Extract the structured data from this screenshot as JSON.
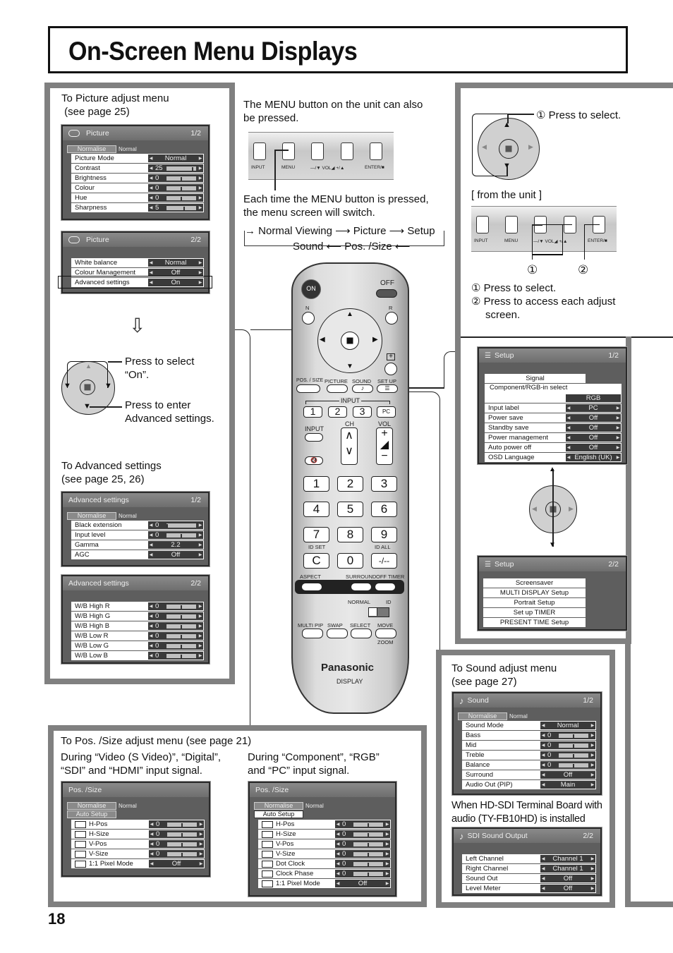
{
  "page": {
    "title": "On-Screen Menu Displays",
    "number": "18"
  },
  "left": {
    "picture_caption": [
      "To Picture adjust menu",
      " (see page 25)"
    ],
    "press_select": [
      "Press to select",
      "“On”."
    ],
    "press_enter": [
      "Press to enter",
      "Advanced settings."
    ],
    "adv_caption": [
      "To Advanced settings",
      "(see page 25, 26)"
    ]
  },
  "picture1": {
    "title": "Picture",
    "page": "1/2",
    "normalise": "Normalise",
    "normal_text": "Normal",
    "rows": [
      {
        "label": "Picture Mode",
        "value": "Normal"
      },
      {
        "label": "Contrast",
        "value": "25",
        "slider": 0.9
      },
      {
        "label": "Brightness",
        "value": "0",
        "slider": 0.5
      },
      {
        "label": "Colour",
        "value": "0",
        "slider": 0.5
      },
      {
        "label": "Hue",
        "value": "0",
        "slider": 0.5
      },
      {
        "label": "Sharpness",
        "value": "5",
        "slider": 0.6
      }
    ]
  },
  "picture2": {
    "title": "Picture",
    "page": "2/2",
    "rows": [
      {
        "label": "White balance",
        "value": "Normal"
      },
      {
        "label": "Colour Management",
        "value": "Off"
      },
      {
        "label": "Advanced settings",
        "value": "On"
      }
    ]
  },
  "adv1": {
    "title": "Advanced settings",
    "page": "1/2",
    "normalise": "Normalise",
    "normal_text": "Normal",
    "rows": [
      {
        "label": "Black extension",
        "value": "0",
        "slider": 0.0
      },
      {
        "label": "Input level",
        "value": "0",
        "slider": 0.5
      },
      {
        "label": "Gamma",
        "value": "2.2"
      },
      {
        "label": "AGC",
        "value": "Off"
      }
    ]
  },
  "adv2": {
    "title": "Advanced settings",
    "page": "2/2",
    "rows": [
      {
        "label": "W/B High R",
        "value": "0",
        "slider": 0.5
      },
      {
        "label": "W/B High G",
        "value": "0",
        "slider": 0.5
      },
      {
        "label": "W/B High B",
        "value": "0",
        "slider": 0.5
      },
      {
        "label": "W/B Low R",
        "value": "0",
        "slider": 0.5
      },
      {
        "label": "W/B Low G",
        "value": "0",
        "slider": 0.5
      },
      {
        "label": "W/B Low B",
        "value": "0",
        "slider": 0.5
      }
    ]
  },
  "center": {
    "menu_note": [
      "The MENU button on the unit can also",
      "be pressed."
    ],
    "each_time": [
      "Each time the MENU button is pressed,",
      "the menu screen will switch."
    ],
    "cycle": {
      "a": "Normal Viewing",
      "b": "Picture",
      "c": "Setup",
      "d": "Sound",
      "e": "Pos. /Size"
    },
    "unit_labels": [
      "INPUT",
      "MENU",
      "—/▼ VOL◢ +/▲",
      "ENTER/■"
    ]
  },
  "remote": {
    "on": "ON",
    "off": "OFF",
    "n": "N",
    "r": "R",
    "pos_size": "POS. / SIZE",
    "picture": "PICTURE",
    "sound": "SOUND",
    "setup": "SET UP",
    "input_group": "INPUT",
    "keys_top": [
      "1",
      "2",
      "3",
      "PC"
    ],
    "input": "INPUT",
    "ch": "CH",
    "vol": "VOL",
    "numpad": [
      "1",
      "2",
      "3",
      "4",
      "5",
      "6",
      "7",
      "8",
      "9",
      "C",
      "0",
      "-/--"
    ],
    "id_set": "ID SET",
    "id_all": "ID ALL",
    "aspect": "ASPECT",
    "surround": "SURROUND",
    "off_timer": "OFF TIMER",
    "normal": "NORMAL",
    "id": "ID",
    "multi_pip": "MULTI PIP",
    "swap": "SWAP",
    "select": "SELECT",
    "move": "MOVE",
    "zoom": "ZOOM",
    "brand": "Panasonic",
    "display": "DISPLAY"
  },
  "right": {
    "press1": "① Press to select.",
    "from_unit": "[ from the unit ]",
    "c1": "①",
    "c2": "②",
    "note1": "① Press to select.",
    "note2": [
      "② Press to access each adjust",
      "screen."
    ]
  },
  "setup1": {
    "title": "Setup",
    "page": "1/2",
    "signal": "Signal",
    "comp": "Component/RGB-in select",
    "comp_value": "RGB",
    "rows": [
      {
        "label": "Input label",
        "value": "PC"
      },
      {
        "label": "Power save",
        "value": "Off"
      },
      {
        "label": "Standby save",
        "value": "Off"
      },
      {
        "label": "Power management",
        "value": "Off"
      },
      {
        "label": "Auto power off",
        "value": "Off"
      },
      {
        "label": "OSD Language",
        "value": "English (UK)"
      }
    ]
  },
  "setup2": {
    "title": "Setup",
    "page": "2/2",
    "items": [
      "Screensaver",
      "MULTI DISPLAY Setup",
      "Portrait Setup",
      "Set up TIMER",
      "PRESENT TIME Setup"
    ]
  },
  "sound": {
    "caption": [
      "To Sound adjust menu",
      "(see page 27)"
    ],
    "title": "Sound",
    "page": "1/2",
    "normalise": "Normalise",
    "normal_text": "Normal",
    "rows": [
      {
        "label": "Sound Mode",
        "value": "Normal"
      },
      {
        "label": "Bass",
        "value": "0",
        "slider": 0.5
      },
      {
        "label": "Mid",
        "value": "0",
        "slider": 0.5
      },
      {
        "label": "Treble",
        "value": "0",
        "slider": 0.5
      },
      {
        "label": "Balance",
        "value": "0",
        "slider": 0.5
      },
      {
        "label": "Surround",
        "value": "Off"
      },
      {
        "label": "Audio Out (PIP)",
        "value": "Main"
      }
    ],
    "hdsdi_note": [
      "When HD-SDI Terminal Board with",
      "audio (TY-FB10HD) is installed"
    ]
  },
  "sdi": {
    "title": "SDI Sound Output",
    "page": "2/2",
    "rows": [
      {
        "label": "Left Channel",
        "value": "Channel 1"
      },
      {
        "label": "Right Channel",
        "value": "Channel 1"
      },
      {
        "label": "Sound Out",
        "value": "Off"
      },
      {
        "label": "Level Meter",
        "value": "Off"
      }
    ]
  },
  "possize": {
    "caption": "To Pos. /Size adjust menu (see page 21)",
    "left_caption": [
      "During “Video (S Video)”, “Digital”,",
      "“SDI” and “HDMI” input signal."
    ],
    "right_caption": [
      "During “Component”, “RGB”",
      "and “PC” input signal."
    ],
    "title": "Pos. /Size",
    "normalise": "Normalise",
    "normal_text": "Normal",
    "auto_setup": "Auto Setup",
    "rows_a": [
      {
        "label": "H-Pos",
        "value": "0",
        "slider": 0.5
      },
      {
        "label": "H-Size",
        "value": "0",
        "slider": 0.5
      },
      {
        "label": "V-Pos",
        "value": "0",
        "slider": 0.5
      },
      {
        "label": "V-Size",
        "value": "0",
        "slider": 0.5
      },
      {
        "label": "1:1 Pixel Mode",
        "value": "Off"
      }
    ],
    "rows_b": [
      {
        "label": "H-Pos",
        "value": "0",
        "slider": 0.5
      },
      {
        "label": "H-Size",
        "value": "0",
        "slider": 0.5
      },
      {
        "label": "V-Pos",
        "value": "0",
        "slider": 0.5
      },
      {
        "label": "V-Size",
        "value": "0",
        "slider": 0.5
      },
      {
        "label": "Dot Clock",
        "value": "0",
        "slider": 0.5
      },
      {
        "label": "Clock Phase",
        "value": "0",
        "slider": 0.5
      },
      {
        "label": "1:1 Pixel Mode",
        "value": "Off"
      }
    ]
  }
}
